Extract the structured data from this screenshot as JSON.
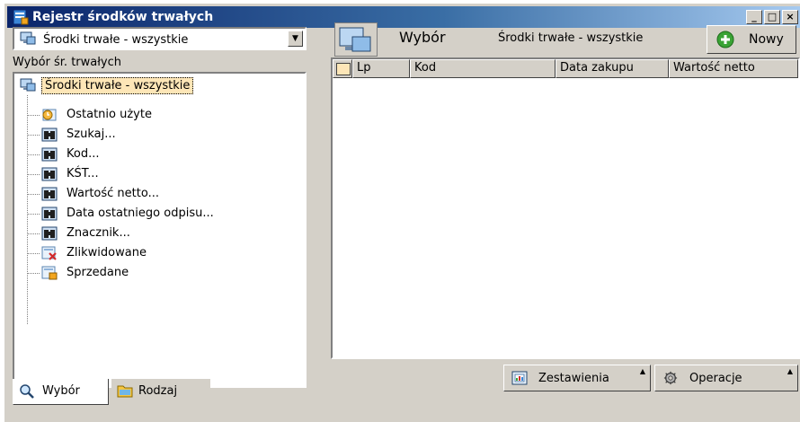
{
  "window": {
    "title": "Rejestr środków trwałych",
    "controls": {
      "minimize": "_",
      "restore": "□",
      "close": "×"
    }
  },
  "left": {
    "combo_value": "Środki trwałe - wszystkie",
    "section_label": "Wybór śr. trwałych",
    "tree_root": "Środki trwałe - wszystkie",
    "tree_items": [
      {
        "label": "Ostatnio użyte",
        "icon": "recent-icon"
      },
      {
        "label": "Szukaj...",
        "icon": "binoculars-icon"
      },
      {
        "label": "Kod...",
        "icon": "binoculars-icon"
      },
      {
        "label": "KŚT...",
        "icon": "binoculars-icon"
      },
      {
        "label": "Wartość netto...",
        "icon": "binoculars-icon"
      },
      {
        "label": "Data ostatniego odpisu...",
        "icon": "binoculars-icon"
      },
      {
        "label": "Znacznik...",
        "icon": "binoculars-icon"
      },
      {
        "label": "Zlikwidowane",
        "icon": "liquidated-icon"
      },
      {
        "label": "Sprzedane",
        "icon": "sold-icon"
      }
    ],
    "tabs": [
      {
        "label": "Wybór",
        "icon": "magnifier-icon"
      },
      {
        "label": "Rodzaj",
        "icon": "folder-icon"
      }
    ]
  },
  "right": {
    "wybor_label": "Wybór",
    "filter_label": "Środki trwałe - wszystkie",
    "new_button": "Nowy",
    "columns": [
      "Lp",
      "Kod",
      "Data zakupu",
      "Wartość netto"
    ],
    "bottom_buttons": [
      {
        "label": "Zestawienia",
        "icon": "report-icon"
      },
      {
        "label": "Operacje",
        "icon": "gear-icon"
      }
    ]
  },
  "colors": {
    "title_gradient_start": "#0a246a",
    "face": "#d4d0c8",
    "highlight": "#fde6b7",
    "new_green": "#3aa335"
  }
}
